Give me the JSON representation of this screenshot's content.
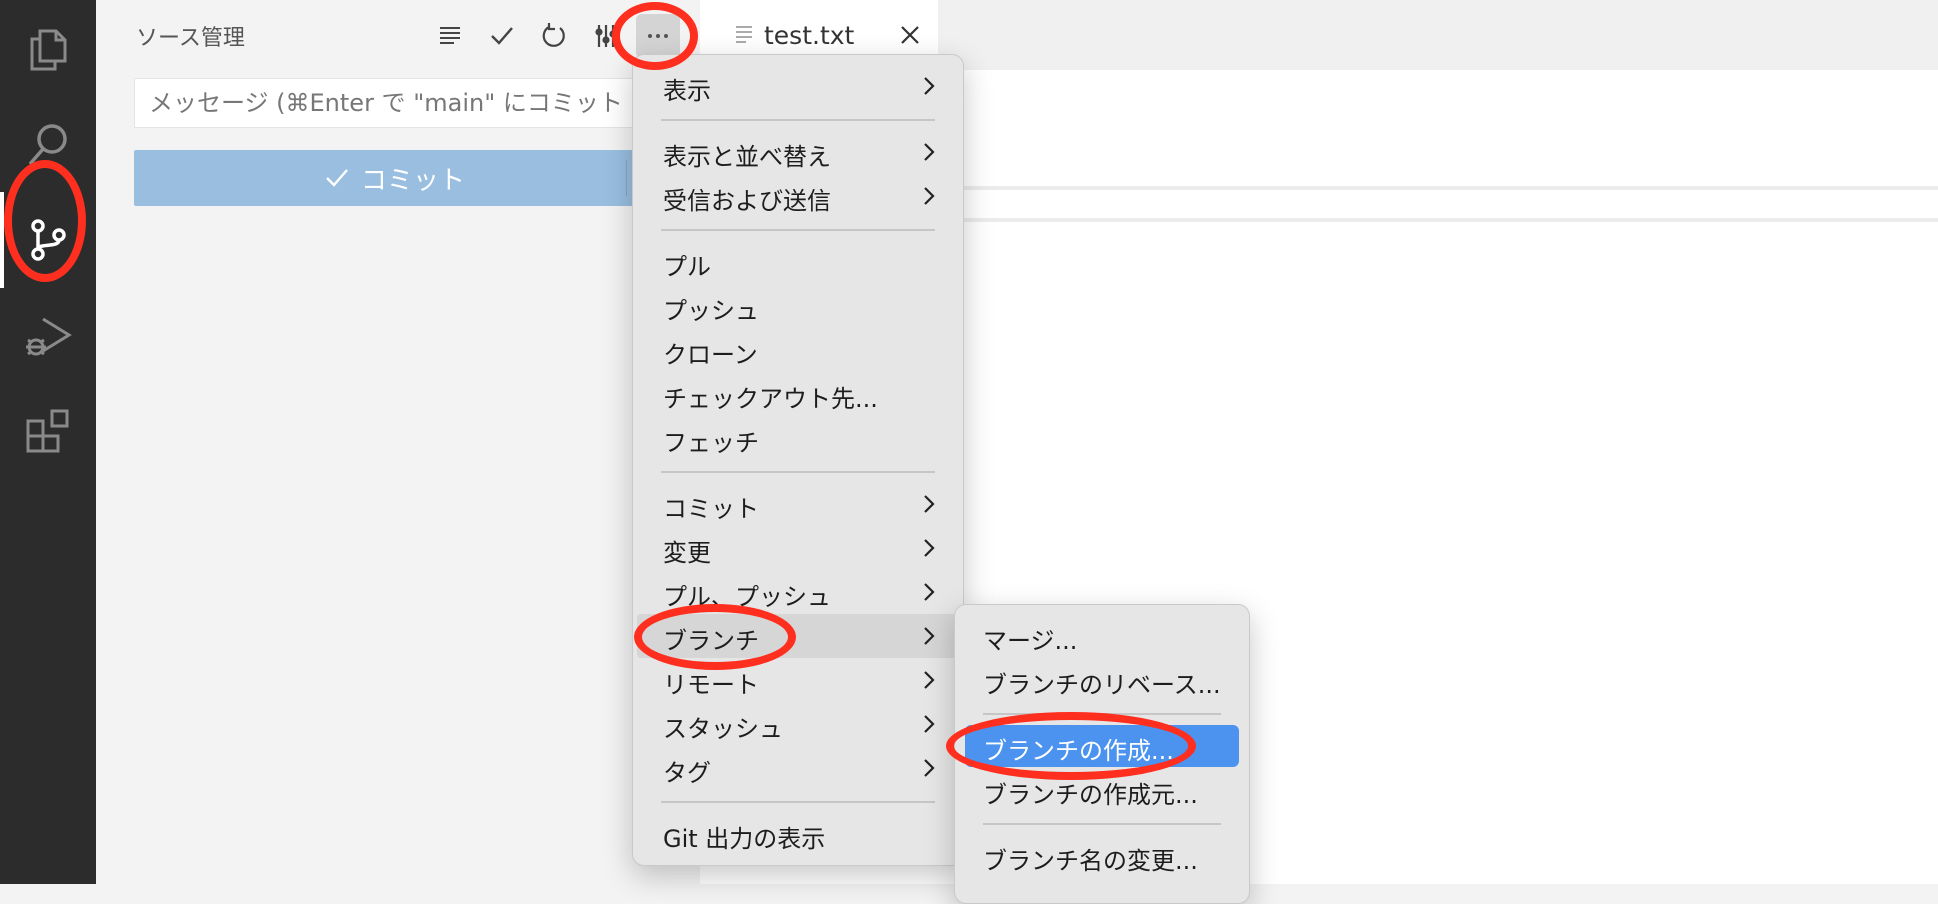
{
  "sidebar": {
    "title": "ソース管理",
    "toolbar_icons": [
      "list-icon",
      "check-icon",
      "refresh-icon",
      "graph-icon",
      "more-icon"
    ],
    "commit_message_placeholder": "メッセージ (⌘Enter で \"main\" にコミット",
    "commit_button_label": "コミット"
  },
  "activity_bar": {
    "icons": [
      "files-icon",
      "search-icon",
      "source-control-icon",
      "run-debug-icon",
      "extensions-icon"
    ],
    "active": "source-control-icon"
  },
  "editor": {
    "tab_label": "test.txt"
  },
  "main_menu": {
    "items": [
      {
        "label": "表示",
        "submenu": true
      },
      {
        "label": "表示と並べ替え",
        "submenu": true
      },
      {
        "label": "受信および送信",
        "submenu": true
      },
      {
        "label": "プル",
        "submenu": false
      },
      {
        "label": "プッシュ",
        "submenu": false
      },
      {
        "label": "クローン",
        "submenu": false
      },
      {
        "label": "チェックアウト先...",
        "submenu": false
      },
      {
        "label": "フェッチ",
        "submenu": false
      },
      {
        "label": "コミット",
        "submenu": true
      },
      {
        "label": "変更",
        "submenu": true
      },
      {
        "label": "プル、プッシュ",
        "submenu": true
      },
      {
        "label": "ブランチ",
        "submenu": true
      },
      {
        "label": "リモート",
        "submenu": true
      },
      {
        "label": "スタッシュ",
        "submenu": true
      },
      {
        "label": "タグ",
        "submenu": true
      },
      {
        "label": "Git 出力の表示",
        "submenu": false
      }
    ],
    "highlighted": "ブランチ"
  },
  "branch_submenu": {
    "items": [
      {
        "label": "マージ..."
      },
      {
        "label": "ブランチのリベース..."
      },
      {
        "label": "ブランチの作成..."
      },
      {
        "label": "ブランチの作成元..."
      },
      {
        "label": "ブランチ名の変更..."
      }
    ],
    "selected": "ブランチの作成..."
  },
  "colors": {
    "activity_bar": "#2c2c2c",
    "commit_button": "#99bee0",
    "menu_selection": "#4b93ef",
    "annotation": "#ff2f1f"
  }
}
